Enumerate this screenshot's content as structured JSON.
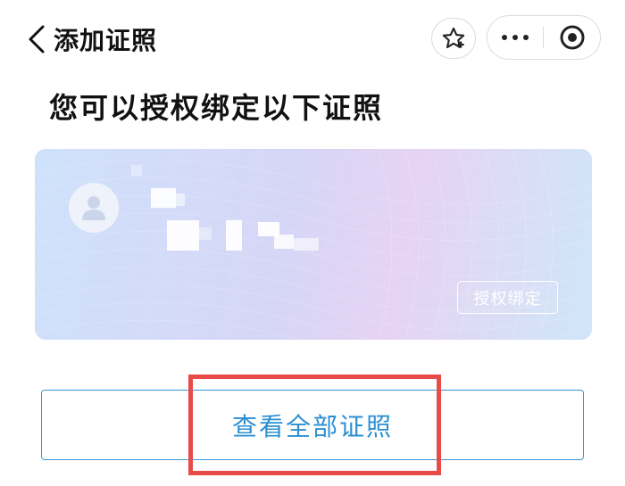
{
  "nav": {
    "title": "添加证照"
  },
  "page": {
    "heading": "您可以授权绑定以下证照"
  },
  "card": {
    "bind_label": "授权绑定"
  },
  "actions": {
    "view_all_label": "查看全部证照"
  },
  "colors": {
    "accent": "#2b8fd3",
    "highlight": "#e94b48"
  }
}
